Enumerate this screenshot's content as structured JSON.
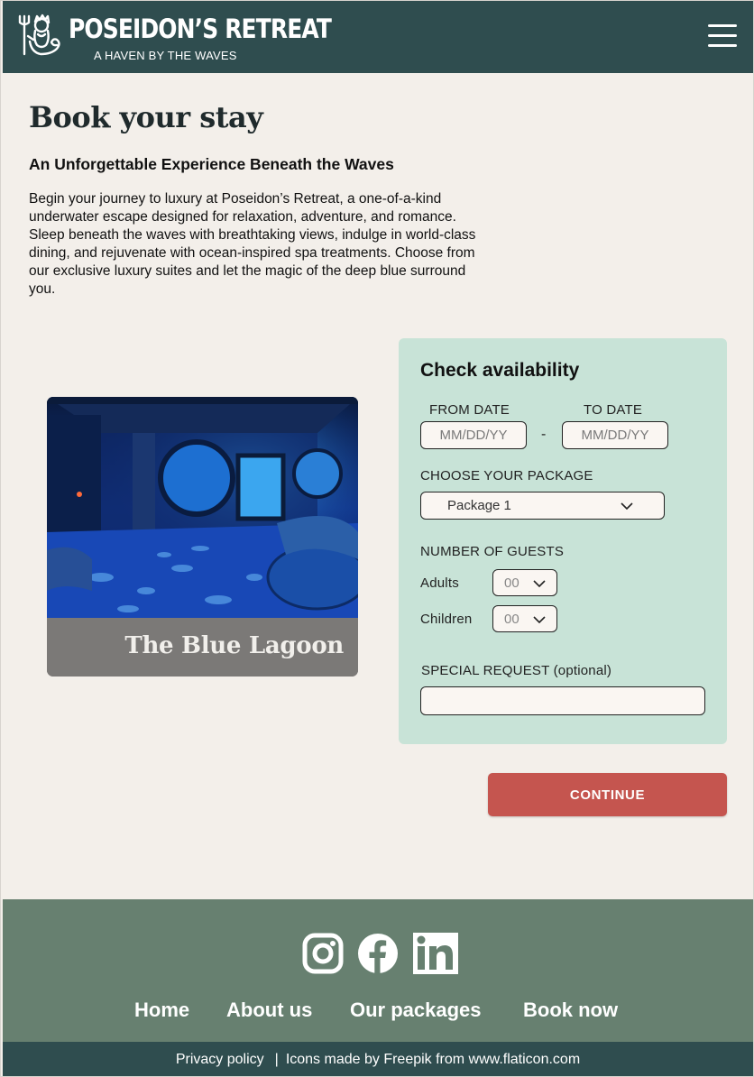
{
  "brand": {
    "title": "POSEIDON’S RETREAT",
    "subtitle": "A HAVEN BY THE WAVES",
    "logo_icon": "poseidon-trident-icon"
  },
  "header": {
    "menu_icon": "hamburger-menu-icon"
  },
  "intro": {
    "title": "Book your stay",
    "subtitle": "An Unforgettable Experience Beneath the Waves",
    "body": "Begin your journey to luxury at Poseidon’s Retreat, a one-of-a-kind underwater escape designed for relaxation, adventure, and romance. Sleep beneath the waves with breathtaking views, indulge in world-class dining, and rejuvenate with ocean-inspired spa treatments. Choose from our exclusive luxury suites and let the magic of the deep blue surround you."
  },
  "suite": {
    "name": "The Blue Lagoon"
  },
  "availability": {
    "title": "Check availability",
    "from_label": "FROM DATE",
    "to_label": "TO DATE",
    "from_placeholder": "MM/DD/YY",
    "to_placeholder": "MM/DD/YY",
    "separator": "-",
    "package_label": "CHOOSE YOUR PACKAGE",
    "package_value": "Package 1",
    "guests_label": "NUMBER OF GUESTS",
    "adults_label": "Adults",
    "adults_value": "00",
    "children_label": "Children",
    "children_value": "00",
    "special_label": "SPECIAL REQUEST (optional)",
    "special_value": ""
  },
  "continue_label": "CONTINUE",
  "footer": {
    "social": [
      "instagram-icon",
      "facebook-icon",
      "linkedin-icon"
    ],
    "nav": [
      "Home",
      "About us",
      "Our packages",
      "Book now"
    ],
    "privacy": "Privacy policy",
    "separator": "|",
    "credits": "Icons made by Freepik from www.flaticon.com"
  },
  "colors": {
    "header_bg": "#2f4d4f",
    "page_bg": "#f3efea",
    "panel_bg": "#c8e3d7",
    "button_bg": "#c5554f",
    "footer_bg": "#678070"
  }
}
